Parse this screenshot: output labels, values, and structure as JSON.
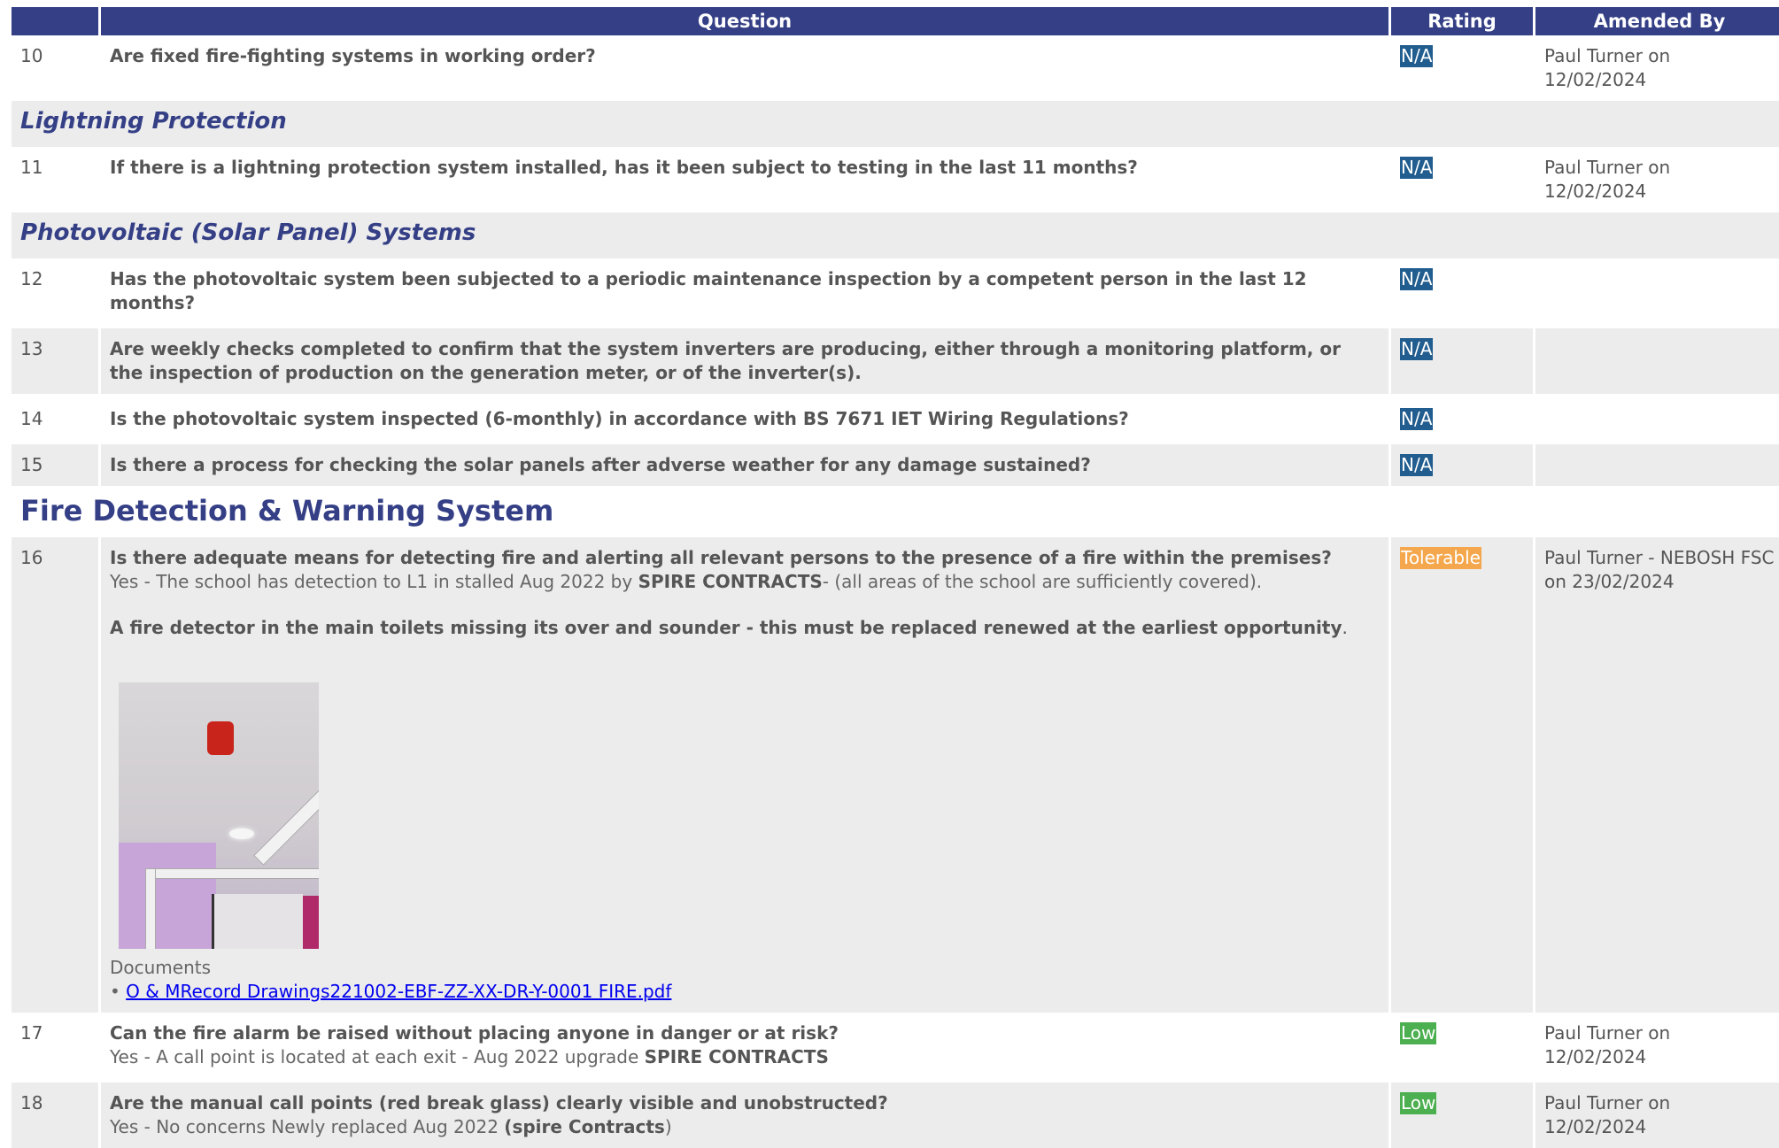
{
  "headers": {
    "number": "",
    "question": "Question",
    "rating": "Rating",
    "amended_by": "Amended By"
  },
  "rows": {
    "q10": {
      "num": "10",
      "question": "Are fixed fire-fighting systems in working order?",
      "rating": "N/A",
      "amended": "Paul Turner on 12/02/2024"
    },
    "lightning": "Lightning Protection",
    "q11": {
      "num": "11",
      "question": "If there is a lightning protection system installed, has it been subject to testing in the last 11 months?",
      "rating": "N/A",
      "amended": "Paul Turner on 12/02/2024"
    },
    "pv": "Photovoltaic (Solar Panel) Systems",
    "q12": {
      "num": "12",
      "question": "Has the photovoltaic system been subjected to a periodic maintenance inspection by a competent person in the last 12 months?",
      "rating": "N/A",
      "amended": ""
    },
    "q13": {
      "num": "13",
      "question": "Are weekly checks completed to confirm that the system inverters are producing, either through a monitoring platform, or the inspection of production on the generation meter, or of the inverter(s).",
      "rating": "N/A",
      "amended": ""
    },
    "q14": {
      "num": "14",
      "question": "Is the photovoltaic system inspected (6-monthly) in accordance with BS 7671 IET Wiring Regulations?",
      "rating": "N/A",
      "amended": ""
    },
    "q15": {
      "num": "15",
      "question": "Is there a process for checking the solar panels after adverse weather for any damage sustained?",
      "rating": "N/A",
      "amended": ""
    },
    "fire_section": "Fire Detection & Warning System",
    "q16": {
      "num": "16",
      "question": "Is there adequate means for detecting fire and alerting all relevant persons to the presence of a fire within the premises?",
      "answer_pre": "Yes - The school has detection to L1 in stalled Aug 2022 by ",
      "answer_bold": "SPIRE CONTRACTS",
      "answer_post": "- (all areas of the school are sufficiently covered).",
      "note_bold": "A fire detector in the main toilets missing its over and sounder - this must be replaced renewed at the earliest opportunity",
      "note_tail": ".",
      "documents_label": "Documents",
      "document_bullet": "• ",
      "document_link": "O & MRecord Drawings221002-EBF-ZZ-XX-DR-Y-0001 FIRE.pdf",
      "rating": "Tolerable",
      "amended": "Paul Turner - NEBOSH FSC on 23/02/2024"
    },
    "q17": {
      "num": "17",
      "question": "Can the fire alarm be raised without placing anyone in danger or at risk?",
      "answer_pre": "Yes - A call point is located at each exit - Aug 2022 upgrade ",
      "answer_bold": "SPIRE CONTRACTS",
      "rating": "Low",
      "amended": "Paul Turner on 12/02/2024"
    },
    "q18": {
      "num": "18",
      "question": "Are the manual call points (red break glass) clearly visible and unobstructed?",
      "answer_pre": "Yes - No concerns Newly replaced Aug 2022 ",
      "answer_bold": "(spire Contracts",
      "answer_post": ")",
      "rating": "Low",
      "amended": "Paul Turner on 12/02/2024"
    }
  },
  "colors": {
    "header": "#343f86",
    "na": "#215d8f",
    "tolerable": "#f4a74c",
    "low": "#4caf50"
  }
}
